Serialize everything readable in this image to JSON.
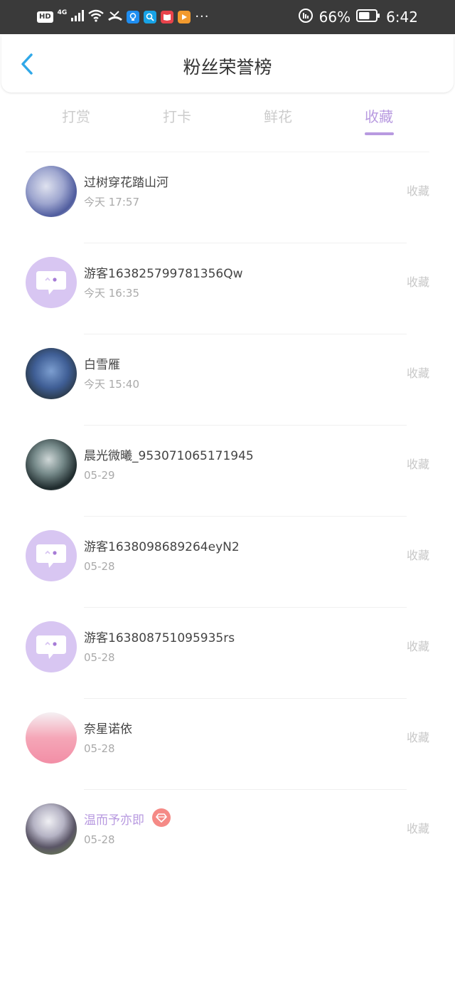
{
  "status_bar": {
    "hd": "HD",
    "network": "4G",
    "more": "···",
    "battery_percent": "66%",
    "time": "6:42",
    "battery_level": 0.66
  },
  "header": {
    "title": "粉丝荣誉榜",
    "accent_color": "#30A8E8"
  },
  "tabs": [
    {
      "label": "打赏",
      "active": false
    },
    {
      "label": "打卡",
      "active": false
    },
    {
      "label": "鲜花",
      "active": false
    },
    {
      "label": "收藏",
      "active": true
    }
  ],
  "colors": {
    "active": "#B89AE0",
    "inactive": "#CCCCCC",
    "vip_badge": "#F58A86"
  },
  "fans": [
    {
      "name": "过树穿花踏山河",
      "time": "今天 17:57",
      "action": "收藏",
      "avatar": "photo1",
      "vip": false
    },
    {
      "name": "游客163825799781356Qw",
      "time": "今天 16:35",
      "action": "收藏",
      "avatar": "guest",
      "vip": false
    },
    {
      "name": "白雪雁",
      "time": "今天 15:40",
      "action": "收藏",
      "avatar": "photo2",
      "vip": false
    },
    {
      "name": "晨光微曦_953071065171945",
      "time": "05-29",
      "action": "收藏",
      "avatar": "photo3",
      "vip": false
    },
    {
      "name": "游客1638098689264eyN2",
      "time": "05-28",
      "action": "收藏",
      "avatar": "guest",
      "vip": false
    },
    {
      "name": "游客163808751095935rs",
      "time": "05-28",
      "action": "收藏",
      "avatar": "guest",
      "vip": false
    },
    {
      "name": "奈星诺依",
      "time": "05-28",
      "action": "收藏",
      "avatar": "photo4",
      "vip": false
    },
    {
      "name": "温而予亦即",
      "time": "05-28",
      "action": "收藏",
      "avatar": "photo5",
      "vip": true
    }
  ]
}
